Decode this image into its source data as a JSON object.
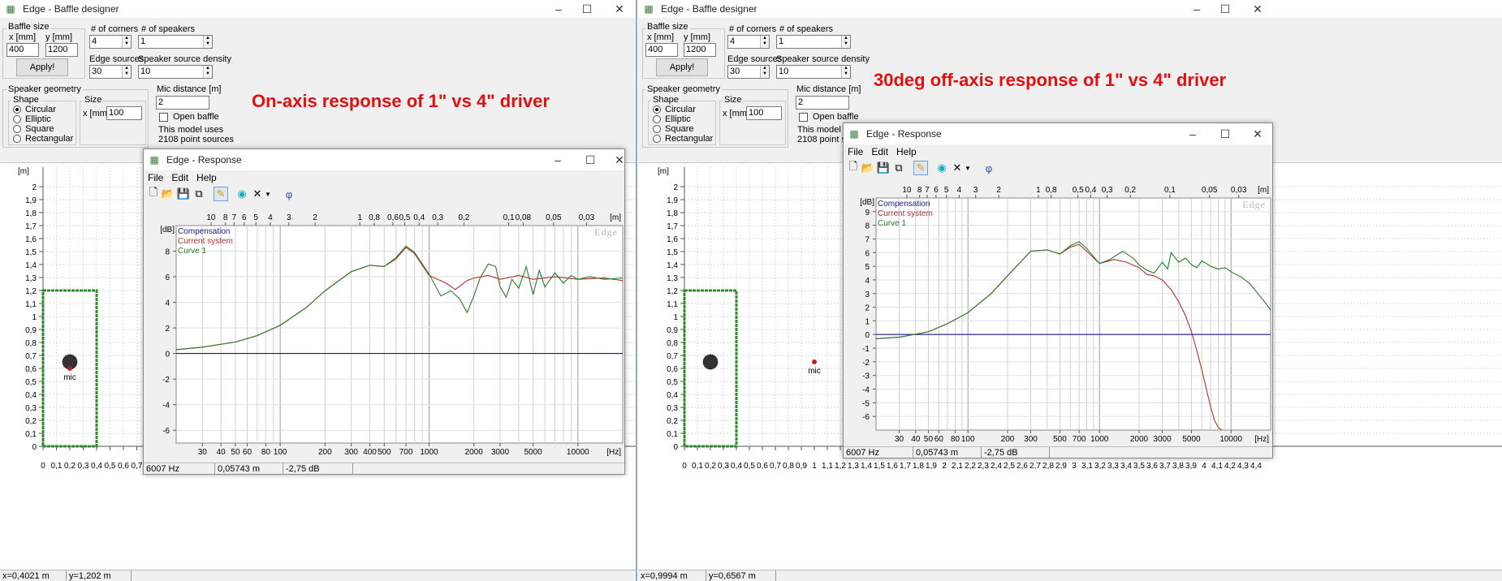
{
  "left": {
    "window_title": "Edge - Baffle designer",
    "baffle_size": {
      "group": "Baffle size",
      "x_label": "x [mm]",
      "y_label": "y [mm]",
      "x_value": "400",
      "y_value": "1200",
      "apply_label": "Apply!"
    },
    "corners": {
      "label": "# of corners",
      "value": "4"
    },
    "speakers": {
      "label": "# of speakers",
      "value": "1"
    },
    "edge_sources": {
      "label": "Edge sources",
      "value": "30"
    },
    "density": {
      "label": "Speaker source density",
      "value": "10"
    },
    "geometry": {
      "group": "Speaker geometry",
      "shape_group": "Shape",
      "shapes": [
        "Circular",
        "Elliptic",
        "Square",
        "Rectangular"
      ],
      "selected": "Circular",
      "size_group": "Size",
      "size_label": "x [mm]",
      "size_value": "100"
    },
    "mic": {
      "label": "Mic distance [m]",
      "value": "2",
      "open_baffle": "Open baffle",
      "info1": "This model uses",
      "info2": "2108 point sources",
      "mic_tag": "mic"
    },
    "annotation": "On-axis response of 1\" vs 4\" driver",
    "layout_y_unit": "[m]",
    "layout_y_ticks": [
      "2",
      "1,9",
      "1,8",
      "1,7",
      "1,6",
      "1,5",
      "1,4",
      "1,3",
      "1,2",
      "1,1",
      "1",
      "0,9",
      "0,8",
      "0,7",
      "0,6",
      "0,5",
      "0,4",
      "0,3",
      "0,2",
      "0,1",
      "0"
    ],
    "layout_x_ticks": [
      "0",
      "0,1",
      "0,2",
      "0,3",
      "0,4",
      "0,5",
      "0,6",
      "0,7"
    ],
    "status": {
      "x": "x=0,4021 m",
      "y": "y=1,202 m"
    },
    "response": {
      "title": "Edge - Response",
      "menu": [
        "File",
        "Edit",
        "Help"
      ],
      "status": [
        "6007 Hz",
        "0,05743 m",
        "-2,75 dB"
      ]
    }
  },
  "right": {
    "window_title": "Edge - Baffle designer",
    "baffle_size": {
      "group": "Baffle size",
      "x_label": "x [mm]",
      "y_label": "y [mm]",
      "x_value": "400",
      "y_value": "1200",
      "apply_label": "Apply!"
    },
    "corners": {
      "label": "# of corners",
      "value": "4"
    },
    "speakers": {
      "label": "# of speakers",
      "value": "1"
    },
    "edge_sources": {
      "label": "Edge sources",
      "value": "30"
    },
    "density": {
      "label": "Speaker source density",
      "value": "10"
    },
    "geometry": {
      "group": "Speaker geometry",
      "shape_group": "Shape",
      "shapes": [
        "Circular",
        "Elliptic",
        "Square",
        "Rectangular"
      ],
      "selected": "Circular",
      "size_group": "Size",
      "size_label": "x [mm]",
      "size_value": "100"
    },
    "mic": {
      "label": "Mic distance [m]",
      "value": "2",
      "open_baffle": "Open baffle",
      "info1": "This model us",
      "info2": "2108 point so",
      "mic_tag": "mic"
    },
    "annotation": "30deg off-axis response of 1\" vs 4\" driver",
    "layout_y_unit": "[m]",
    "layout_y_ticks": [
      "2",
      "1,9",
      "1,8",
      "1,7",
      "1,6",
      "1,5",
      "1,4",
      "1,3",
      "1,2",
      "1,1",
      "1",
      "0,9",
      "0,8",
      "0,7",
      "0,6",
      "0,5",
      "0,4",
      "0,3",
      "0,2",
      "0,1",
      "0"
    ],
    "layout_x_ticks": [
      "0",
      "0,1",
      "0,2",
      "0,3",
      "0,4",
      "0,5",
      "0,6",
      "0,7",
      "0,8",
      "0,9",
      "1",
      "1,1",
      "1,2",
      "1,3",
      "1,4",
      "1,5",
      "1,6",
      "1,7",
      "1,8",
      "1,9",
      "2",
      "2,1",
      "2,2",
      "2,3",
      "2,4",
      "2,5",
      "2,6",
      "2,7",
      "2,8",
      "2,9",
      "3",
      "3,1",
      "3,2",
      "3,3",
      "3,4",
      "3,5",
      "3,6",
      "3,7",
      "3,8",
      "3,9",
      "4",
      "4,1",
      "4,2",
      "4,3",
      "4,4"
    ],
    "status": {
      "x": "x=0,9994 m",
      "y": "y=0,6567 m"
    },
    "response": {
      "title": "Edge - Response",
      "menu": [
        "File",
        "Edit",
        "Help"
      ],
      "status": [
        "6007 Hz",
        "0,05743 m",
        "-2,75 dB"
      ]
    }
  },
  "colors": {
    "compensation": "#1a1a8c",
    "current": "#b03030",
    "curve1": "#2a7a2a",
    "annotation": "#e01010",
    "baffle": "#2e8b2e"
  },
  "chart_data": [
    {
      "type": "line",
      "title": "",
      "xlabel": "[Hz]",
      "ylabel": "[dB]",
      "x_scale": "log",
      "xlim": [
        20,
        20000
      ],
      "ylim": [
        -7,
        10
      ],
      "x_ticks": [
        "30",
        "40",
        "50",
        "60",
        "80",
        "100",
        "200",
        "300",
        "400",
        "500",
        "700",
        "1000",
        "2000",
        "3000",
        "5000",
        "10000"
      ],
      "y_ticks": [
        "8",
        "6",
        "4",
        "2",
        "0",
        "-2",
        "-4",
        "-6"
      ],
      "top_axis_label": "[m]",
      "top_axis_ticks": [
        "10",
        "8",
        "7",
        "6",
        "5",
        "4",
        "3",
        "2",
        "1",
        "0,8",
        "0,6",
        "0,5",
        "0,4",
        "0,3",
        "0,2",
        "0,1",
        "0,08",
        "0,05",
        "0,03"
      ],
      "legend": [
        "Compensation",
        "Current system",
        "Curve 1"
      ],
      "legend_position": "top-left",
      "watermark": "Edge",
      "grid": true,
      "series": [
        {
          "name": "Compensation",
          "x": [
            20,
            20000
          ],
          "y": [
            0,
            0
          ]
        },
        {
          "name": "Current system",
          "x": [
            20,
            30,
            50,
            70,
            100,
            150,
            200,
            300,
            400,
            500,
            600,
            700,
            800,
            1000,
            1300,
            1500,
            1800,
            2000,
            2500,
            3000,
            4000,
            5000,
            7000,
            10000,
            15000,
            20000
          ],
          "y": [
            0.3,
            0.5,
            0.9,
            1.4,
            2.2,
            3.6,
            4.9,
            6.4,
            6.9,
            6.8,
            7.4,
            8.3,
            7.8,
            6.1,
            5.5,
            5.0,
            5.7,
            5.9,
            6.1,
            5.8,
            6.1,
            5.8,
            6.0,
            5.8,
            5.9,
            5.7
          ]
        },
        {
          "name": "Curve 1",
          "x": [
            20,
            30,
            50,
            70,
            100,
            150,
            200,
            300,
            400,
            500,
            600,
            700,
            800,
            1000,
            1200,
            1400,
            1600,
            1800,
            2000,
            2200,
            2500,
            2800,
            3000,
            3300,
            3600,
            4000,
            4500,
            5000,
            5500,
            6000,
            7000,
            8000,
            9000,
            10000,
            12000,
            15000,
            20000
          ],
          "y": [
            0.3,
            0.5,
            0.9,
            1.4,
            2.2,
            3.6,
            4.9,
            6.4,
            6.9,
            6.8,
            7.5,
            8.4,
            7.9,
            6.2,
            4.5,
            4.9,
            4.3,
            3.2,
            4.5,
            5.9,
            7.0,
            6.8,
            5.2,
            4.4,
            5.8,
            5.1,
            6.8,
            4.6,
            6.5,
            5.2,
            6.3,
            5.5,
            6.1,
            5.8,
            6.0,
            5.8,
            5.9
          ]
        }
      ]
    },
    {
      "type": "line",
      "title": "",
      "xlabel": "[Hz]",
      "ylabel": "[dB]",
      "x_scale": "log",
      "xlim": [
        20,
        20000
      ],
      "ylim": [
        -7,
        10
      ],
      "x_ticks": [
        "30",
        "40",
        "50",
        "60",
        "80",
        "100",
        "200",
        "300",
        "500",
        "700",
        "1000",
        "2000",
        "3000",
        "5000",
        "10000"
      ],
      "y_ticks": [
        "9",
        "8",
        "7",
        "6",
        "5",
        "4",
        "3",
        "2",
        "1",
        "0",
        "-1",
        "-2",
        "-3",
        "-4",
        "-5",
        "-6"
      ],
      "top_axis_label": "[m]",
      "top_axis_ticks": [
        "10",
        "8",
        "7",
        "6",
        "5",
        "4",
        "3",
        "2",
        "1",
        "0,8",
        "0,5",
        "0,4",
        "0,3",
        "0,2",
        "0,1",
        "0,05",
        "0,03"
      ],
      "legend": [
        "Compensation",
        "Current system",
        "Curve 1"
      ],
      "legend_position": "top-left",
      "watermark": "Edge",
      "grid": true,
      "series": [
        {
          "name": "Compensation",
          "x": [
            20,
            20000
          ],
          "y": [
            0,
            0
          ]
        },
        {
          "name": "Current system",
          "x": [
            20,
            30,
            50,
            70,
            100,
            150,
            200,
            300,
            400,
            500,
            600,
            700,
            800,
            1000,
            1300,
            1600,
            2000,
            2300,
            2600,
            3000,
            3500,
            4000,
            4500,
            5000,
            5500,
            6000,
            6500,
            7000,
            7500,
            8000,
            8500
          ],
          "y": [
            -0.3,
            -0.2,
            0.2,
            0.8,
            1.6,
            3.0,
            4.3,
            6.1,
            6.2,
            5.9,
            6.4,
            6.6,
            6.1,
            5.2,
            5.5,
            5.3,
            4.9,
            4.4,
            4.3,
            4.0,
            3.3,
            2.4,
            1.4,
            0.2,
            -1.2,
            -2.6,
            -4.0,
            -5.3,
            -6.3,
            -6.8,
            -7
          ]
        },
        {
          "name": "Curve 1",
          "x": [
            20,
            30,
            50,
            70,
            100,
            150,
            200,
            300,
            400,
            500,
            600,
            700,
            800,
            1000,
            1200,
            1500,
            1800,
            2000,
            2300,
            2600,
            2800,
            3000,
            3300,
            3500,
            4000,
            4500,
            5000,
            5500,
            6000,
            7000,
            8000,
            9000,
            10000,
            12000,
            14000,
            16000,
            18000,
            20000
          ],
          "y": [
            -0.3,
            -0.2,
            0.2,
            0.8,
            1.6,
            3.0,
            4.3,
            6.1,
            6.2,
            5.9,
            6.5,
            6.8,
            6.3,
            5.2,
            5.5,
            6.1,
            5.6,
            5.1,
            4.7,
            4.5,
            4.9,
            5.3,
            4.8,
            6.0,
            5.3,
            5.6,
            5.1,
            4.9,
            5.4,
            5.0,
            4.8,
            4.9,
            4.6,
            4.2,
            3.7,
            3.0,
            2.4,
            1.8
          ]
        }
      ]
    }
  ]
}
